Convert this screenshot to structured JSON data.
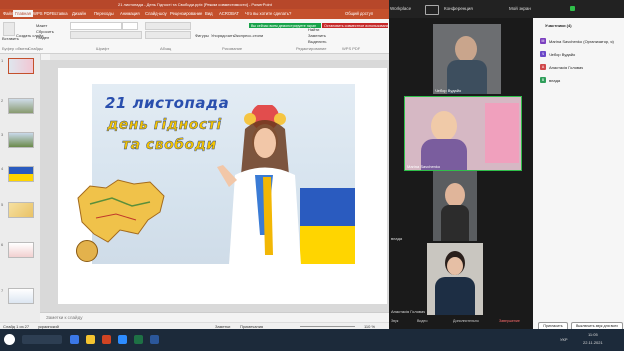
{
  "powerpoint": {
    "title": "21 листопада - День Гідності та Свободи.pptx [Режим совместимости] - PowerPoint",
    "tabs": [
      "Файл",
      "Главная",
      "WPS PDF",
      "Вставка",
      "Дизайн",
      "Переходы",
      "Анимация",
      "Слайд-шоу",
      "Рецензирование",
      "Вид",
      "ACROBAT",
      "Что вы хотите сделать?",
      "Общий доступ"
    ],
    "ribbon": {
      "paste": "Вставить",
      "create_slide": "Создать слайд",
      "cut": "Макет",
      "reset": "Сбросить",
      "section": "Раздел",
      "clipboard": "Буфер обмена",
      "slides": "Слайды",
      "font": "Шрифт",
      "paragraph": "Абзац",
      "figures": "Фигуры",
      "arrange": "Упорядочить",
      "express": "Экспресс-стили",
      "find": "Найти",
      "replace": "Заменить",
      "select": "Выделить",
      "drawing": "Рисование",
      "editing": "Редактирование",
      "wps": "WPS PDF",
      "share_banner": "Вы сейчас всем демонстрируете экран",
      "readonly_banner": "Остановить совместное использование"
    },
    "slide_title": {
      "line1": "21 листопада",
      "line2": "день гідності",
      "line3": "та свободи"
    },
    "thumb_numbers": [
      "1",
      "2",
      "3",
      "4",
      "5",
      "6",
      "7"
    ],
    "notes_placeholder": "Заметки к слайду",
    "status": {
      "slide": "Слайд 1 из 27",
      "lang": "украинский",
      "notes": "Заметки",
      "comments": "Примечания",
      "zoom": "110 %"
    }
  },
  "zoom": {
    "brand": "Workplace",
    "conference": "Конференция",
    "my_screen": "Мой экран",
    "participants_title": "Участники (4)",
    "participants": [
      {
        "name": "Marina Savchenko (Организатор, я)",
        "color": "#7b3fbf",
        "initial": "M"
      },
      {
        "name": "Чебор Вудайо",
        "color": "#6b48c8",
        "initial": "Ч"
      },
      {
        "name": "Анастасія Головач",
        "color": "#d0484a",
        "initial": "А"
      },
      {
        "name": "влада",
        "color": "#2f9e5a",
        "initial": "В"
      }
    ],
    "tiles": [
      {
        "name": "Чебор Вудайо"
      },
      {
        "name": "Marina Savchenko"
      },
      {
        "name": "влада"
      },
      {
        "name": "Анастасія Головач"
      }
    ],
    "toolbar": [
      "Звук",
      "Видео",
      "Дополнительно",
      "Завершение"
    ],
    "invite_button": "Пригласить",
    "mute_all_button": "Выключить звук для всех"
  },
  "taskbar": {
    "lang": "УКР",
    "time": "11:05",
    "date": "22.11.2021"
  }
}
